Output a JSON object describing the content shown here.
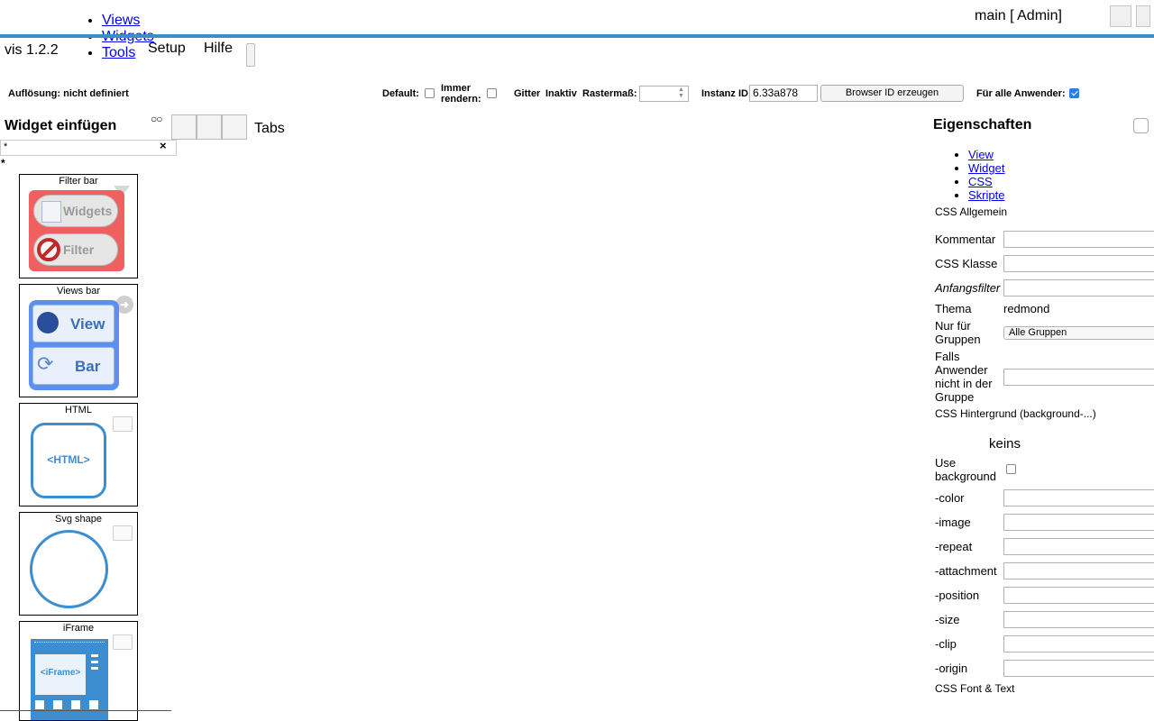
{
  "nav": {
    "menu": [
      "Views",
      "Widgets",
      "Tools"
    ],
    "setup": "Setup",
    "help": "Hilfe",
    "version": "vis 1.2.2",
    "user_label": "main [ Admin]"
  },
  "toolbar": {
    "resolution": "Auflösung: nicht definiert",
    "default_label": "Default:",
    "always_render_label": "Immer rendern:",
    "grid_label": "Gitter",
    "grid_value": "Inaktiv",
    "raster_label": "Rastermaß:",
    "raster_value": "",
    "instance_label": "Instanz ID",
    "instance_value": "6.33a878",
    "browser_id_button": "Browser ID erzeugen",
    "all_users_label": "Für alle Anwender:",
    "all_users_checked": true
  },
  "palette": {
    "title": "Widget einfügen",
    "search_value": "*",
    "filter_text": "*",
    "tabs_label": "Tabs",
    "widgets": [
      {
        "name": "Filter bar",
        "buttons": [
          "Widgets",
          "Filter"
        ]
      },
      {
        "name": "Views bar",
        "buttons": [
          "View",
          "Bar"
        ]
      },
      {
        "name": "HTML",
        "preview": "<HTML>"
      },
      {
        "name": "Svg shape"
      },
      {
        "name": "iFrame",
        "preview": "<iFrame>"
      }
    ]
  },
  "properties": {
    "title": "Eigenschaften",
    "tabs": [
      "View",
      "Widget",
      "CSS",
      "Skripte"
    ],
    "section_general": "CSS Allgemein",
    "comment_label": "Kommentar",
    "css_class_label": "CSS Klasse",
    "initial_filter_label": "Anfangsfilter",
    "theme_label": "Thema",
    "theme_value": "redmond",
    "groups_label": "Nur für Gruppen",
    "groups_value": "Alle Gruppen",
    "not_in_group_label": "Falls Anwender nicht in der Gruppe",
    "section_background": "CSS Hintergrund (background-...)",
    "background_preview": "keins",
    "use_background_label": "Use background",
    "bg_fields": [
      "-color",
      "-image",
      "-repeat",
      "-attachment",
      "-position",
      "-size",
      "-clip",
      "-origin"
    ],
    "section_font": "CSS Font & Text"
  },
  "colors": {
    "accent": "#3a8ec9",
    "filter_bar_bg": "#f06060",
    "views_bar_bg": "#5b8ff0",
    "widget_blue": "#3d8ed1"
  }
}
